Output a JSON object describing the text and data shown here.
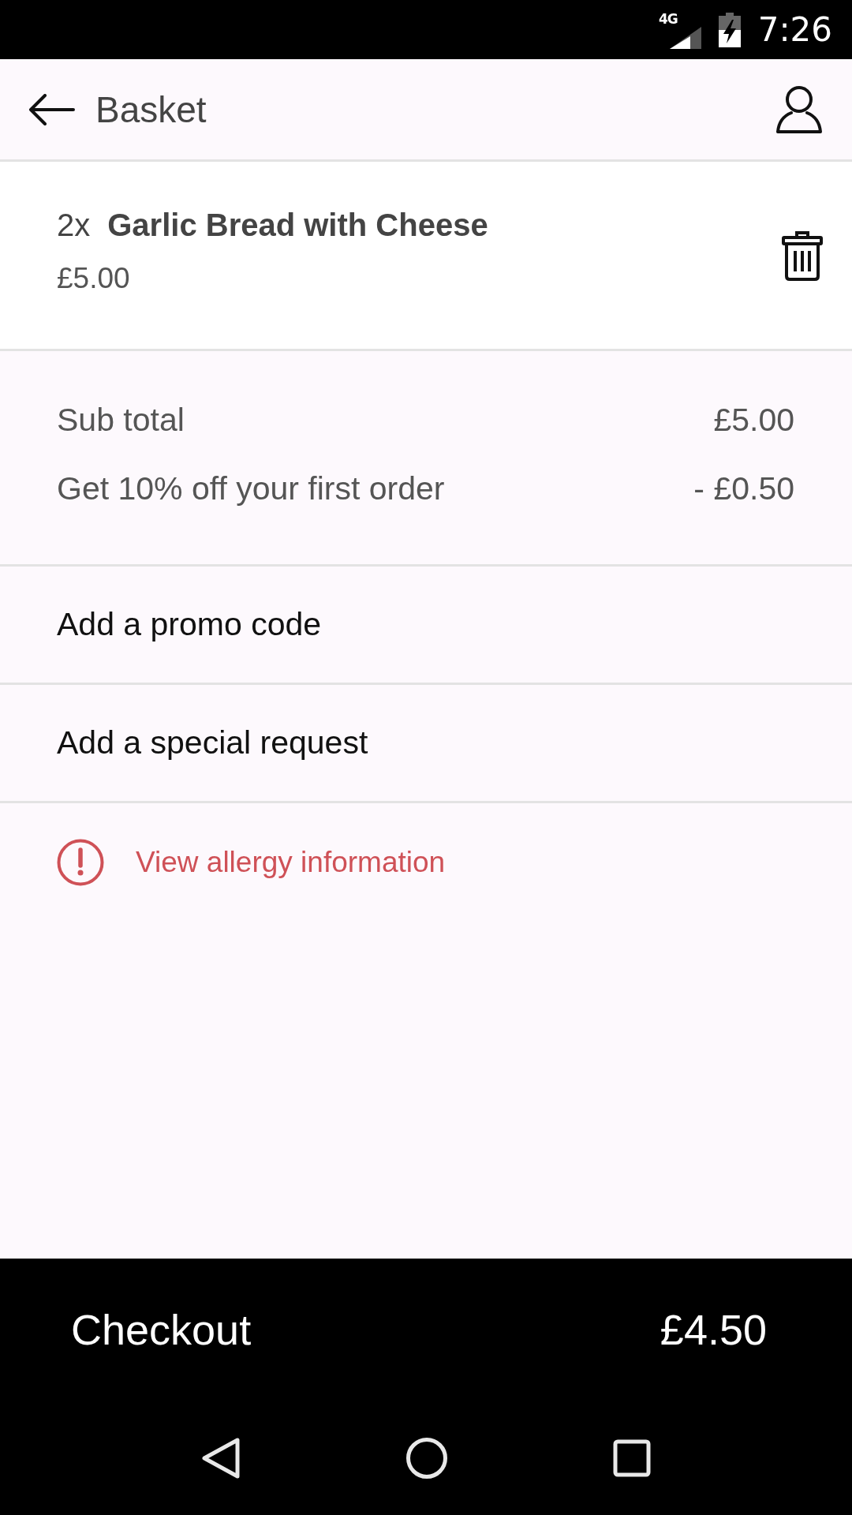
{
  "status_bar": {
    "network": "4G",
    "time": "7:26"
  },
  "header": {
    "title": "Basket"
  },
  "basket_items": [
    {
      "quantity": "2x",
      "name": "Garlic Bread with Cheese",
      "price": "£5.00"
    }
  ],
  "summary": [
    {
      "label": "Sub total",
      "value": "£5.00"
    },
    {
      "label": "Get 10% off your first order",
      "value": "- £0.50"
    }
  ],
  "actions": [
    "Add a promo code",
    "Add a special request"
  ],
  "allergy_link": "View allergy information",
  "checkout": {
    "label": "Checkout",
    "total": "£4.50"
  }
}
